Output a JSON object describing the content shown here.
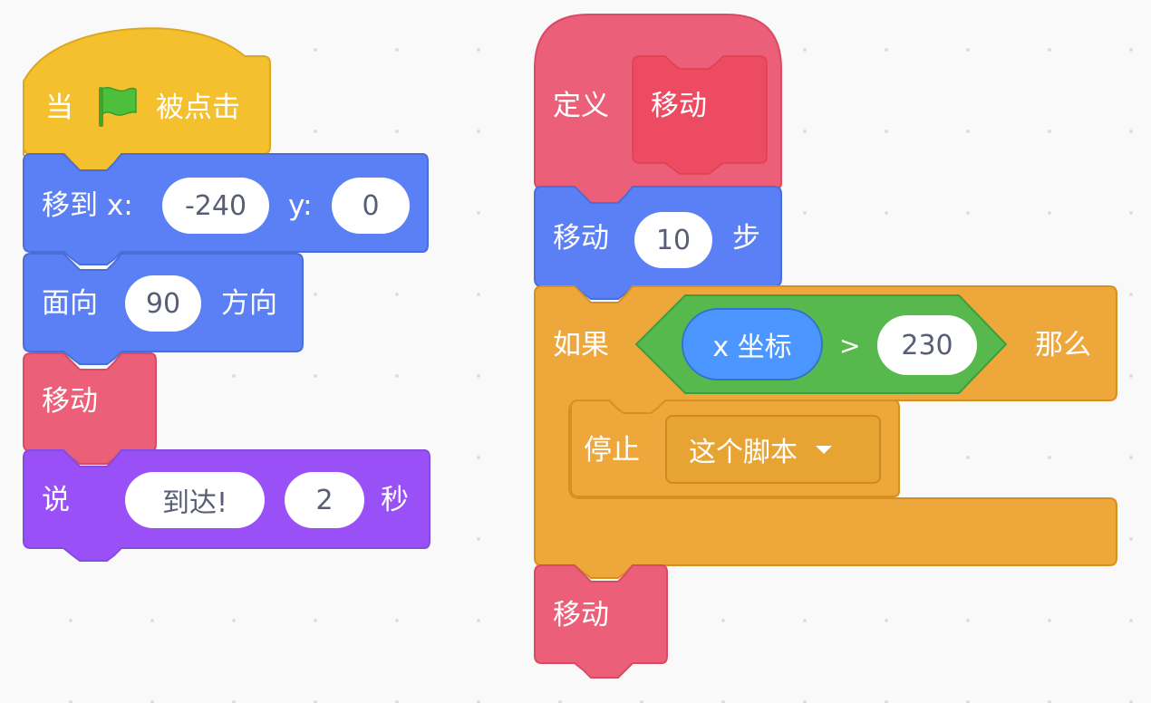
{
  "script_left": {
    "hat": {
      "prefix": "当",
      "flag_icon": "green-flag-icon",
      "suffix": "被点击",
      "color": "#f5c02d"
    },
    "goto_xy": {
      "label": "移到 x:",
      "x_value": "-240",
      "y_label": "y:",
      "y_value": "0",
      "color": "#5b80f6"
    },
    "point_direction": {
      "label": "面向",
      "value": "90",
      "suffix": "方向",
      "color": "#5b80f6"
    },
    "call_move": {
      "label": "移动",
      "color": "#ec5f78"
    },
    "say_for_secs": {
      "label": "说",
      "message": "到达!",
      "secs": "2",
      "suffix": "秒",
      "color": "#9a50f7"
    }
  },
  "script_right": {
    "define": {
      "label": "定义",
      "proc_name": "移动",
      "color": "#ec5f78",
      "proto_color": "#ed4b62"
    },
    "move_steps": {
      "label": "移动",
      "value": "10",
      "suffix": "步",
      "color": "#5b80f6"
    },
    "if_then": {
      "label": "如果",
      "then": "那么",
      "color": "#eea73a",
      "condition": {
        "left": "x 坐标",
        "operator": ">",
        "right": "230",
        "color": "#57b94d"
      }
    },
    "stop": {
      "label": "停止",
      "option": "这个脚本",
      "color": "#eea73a"
    },
    "call_move": {
      "label": "移动",
      "color": "#ec5f78"
    }
  }
}
